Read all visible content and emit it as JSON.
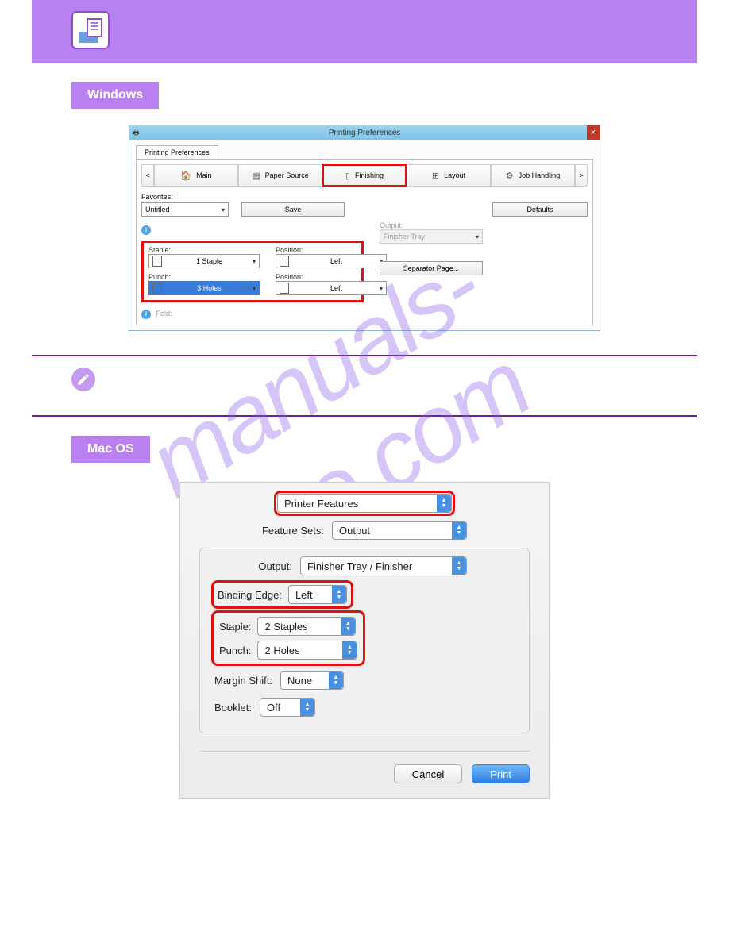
{
  "header": {
    "section_windows": "Windows",
    "section_mac": "Mac OS"
  },
  "watermark": "manuals-hive.com",
  "win": {
    "title": "Printing Preferences",
    "tab": "Printing Preferences",
    "nav": {
      "prev": "<",
      "next": ">",
      "tabs": [
        "Main",
        "Paper Source",
        "Finishing",
        "Layout",
        "Job Handling"
      ]
    },
    "fav_label": "Favorites:",
    "fav_value": "Untitled",
    "save": "Save",
    "defaults": "Defaults",
    "staple_label": "Staple:",
    "staple_value": "1 Staple",
    "pos_label": "Position:",
    "pos_value": "Left",
    "punch_label": "Punch:",
    "punch_value": "3 Holes",
    "pos2_label": "Position:",
    "pos2_value": "Left",
    "output_label": "Output:",
    "output_value": "Finisher Tray",
    "sep": "Separator Page...",
    "fold_label": "Fold:"
  },
  "mac": {
    "top_popup": "Printer Features",
    "fsets_label": "Feature Sets:",
    "fsets_value": "Output",
    "output_label": "Output:",
    "output_value": "Finisher Tray / Finisher",
    "binding_label": "Binding Edge:",
    "binding_value": "Left",
    "staple_label": "Staple:",
    "staple_value": "2 Staples",
    "punch_label": "Punch:",
    "punch_value": "2 Holes",
    "margin_label": "Margin Shift:",
    "margin_value": "None",
    "booklet_label": "Booklet:",
    "booklet_value": "Off",
    "cancel": "Cancel",
    "print": "Print"
  }
}
